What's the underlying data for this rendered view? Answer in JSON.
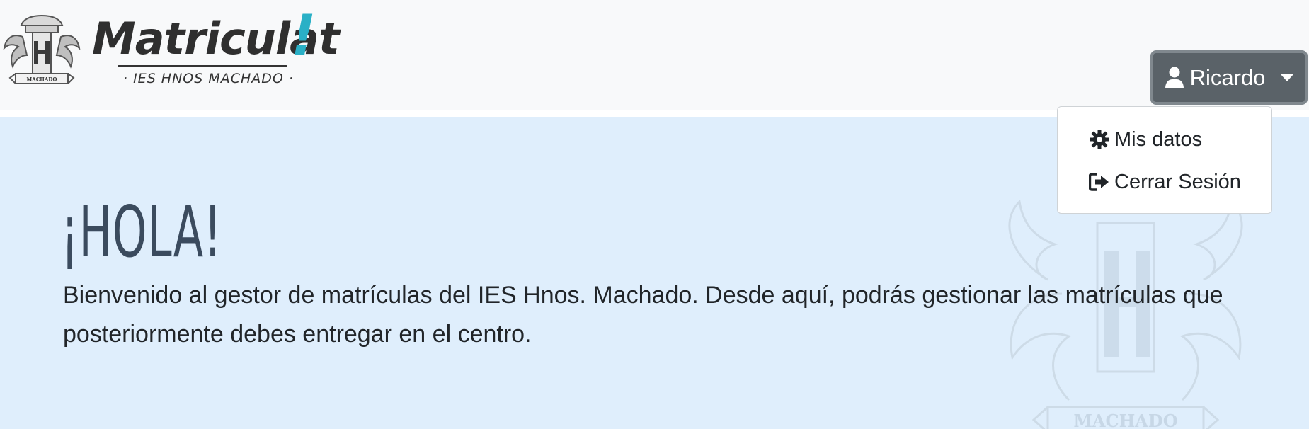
{
  "brand": {
    "wordmark": "Matriculat",
    "wordmark_accent": "!",
    "subtitle": "· IES HNOS  MACHADO ·",
    "emblem_label": "MACHADO",
    "emblem_initials": "H",
    "accent_color": "#2ab0c6"
  },
  "user_menu": {
    "username": "Ricardo",
    "icons": [
      "user-icon",
      "caret-down-icon"
    ],
    "items": [
      {
        "label": "Mis datos",
        "icon": "gear-icon"
      },
      {
        "label": "Cerrar Sesión",
        "icon": "sign-out-icon"
      }
    ]
  },
  "hero": {
    "title": "¡HOLA!",
    "text": "Bienvenido al gestor de matrículas del IES Hnos. Machado. Desde aquí, podrás gestionar las matrículas que posteriormente debes entregar en el centro.",
    "watermark_label": "MACHADO",
    "background": "#dfeefc"
  }
}
